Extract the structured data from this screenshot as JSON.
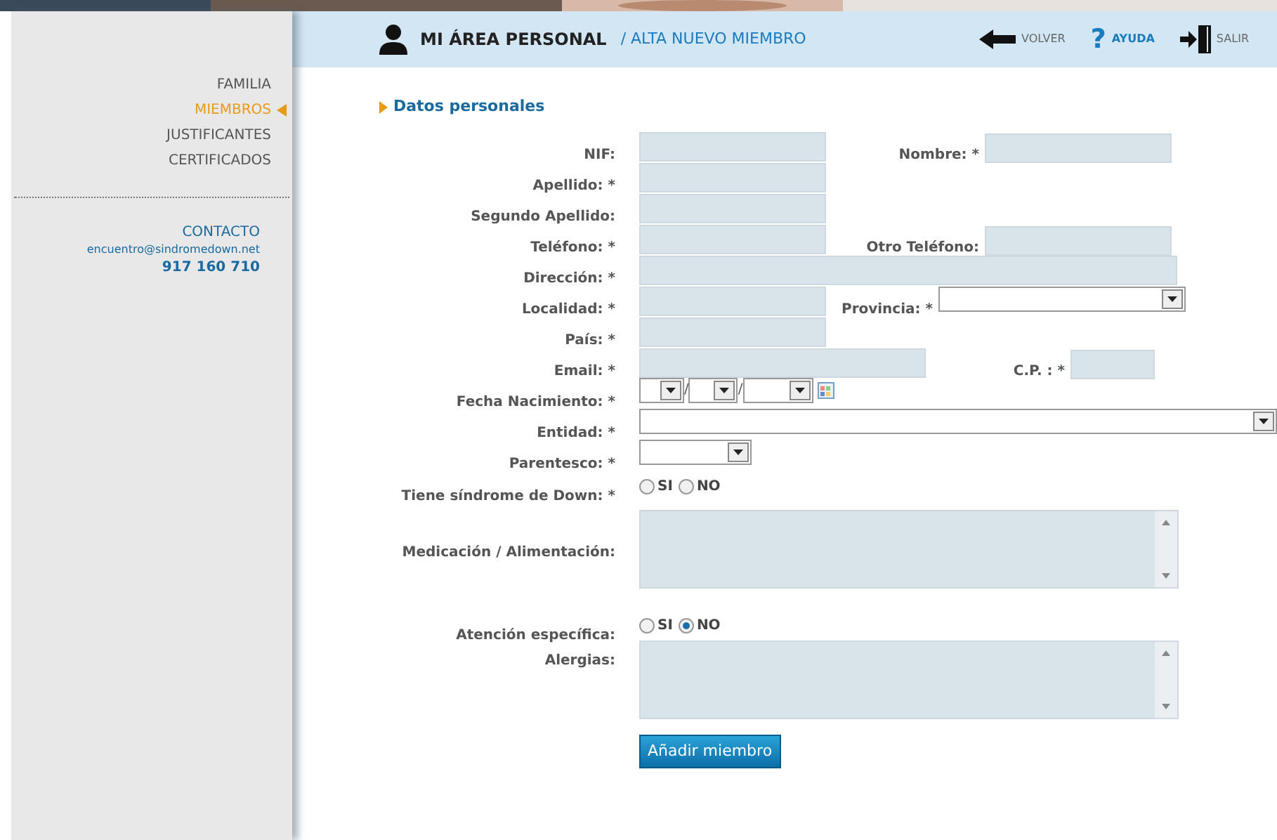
{
  "header": {
    "title": "MI ÁREA PERSONAL",
    "subtitle": "/ ALTA NUEVO MIEMBRO",
    "actions": [
      {
        "kind": "back",
        "label": "VOLVER"
      },
      {
        "kind": "help",
        "icon": "?",
        "label": "AYUDA"
      },
      {
        "kind": "exit",
        "label": "SALIR"
      }
    ]
  },
  "sidebar": {
    "items": [
      {
        "label": "FAMILIA",
        "selected": false
      },
      {
        "label": "MIEMBROS",
        "selected": true
      },
      {
        "label": "JUSTIFICANTES",
        "selected": false
      },
      {
        "label": "CERTIFICADOS",
        "selected": false
      }
    ],
    "contact": {
      "title": "CONTACTO",
      "email": "encuentro@sindromedown.net",
      "phone": "917 160 710"
    }
  },
  "section_title": "Datos personales",
  "rows": [
    {
      "kind": "text",
      "label": "NIF:",
      "second": {
        "kind": "text",
        "label": "Nombre: *"
      }
    },
    {
      "kind": "text",
      "label": "Apellido: *"
    },
    {
      "kind": "text",
      "label": "Segundo Apellido:"
    },
    {
      "kind": "text",
      "label": "Teléfono: *",
      "second": {
        "kind": "text",
        "label": "Otro Teléfono:"
      }
    },
    {
      "kind": "wide",
      "label": "Dirección: *"
    },
    {
      "kind": "text",
      "label": "Localidad: *",
      "second": {
        "kind": "select",
        "label": "Provincia: *"
      }
    },
    {
      "kind": "text",
      "label": "País: *"
    },
    {
      "kind": "email",
      "label": "Email: *",
      "second": {
        "kind": "short",
        "label": "C.P. : *"
      }
    },
    {
      "kind": "date",
      "label": "Fecha Nacimiento: *",
      "separators": [
        "/",
        "/"
      ]
    },
    {
      "kind": "wide-select",
      "label": "Entidad: *"
    },
    {
      "kind": "select",
      "label": "Parentesco: *"
    },
    {
      "kind": "radio",
      "label": "Tiene síndrome de Down: *",
      "options": [
        {
          "label": "SI",
          "selected": false
        },
        {
          "label": "NO",
          "selected": false
        }
      ]
    },
    {
      "kind": "textarea",
      "label": "Medicación / Alimentación:"
    },
    {
      "kind": "radio",
      "label": "Atención específica:",
      "options": [
        {
          "label": "SI",
          "selected": false
        },
        {
          "label": "NO",
          "selected": true
        }
      ]
    },
    {
      "kind": "textarea-top",
      "label": "Alergias:"
    }
  ],
  "submit": "Añadir miembro"
}
